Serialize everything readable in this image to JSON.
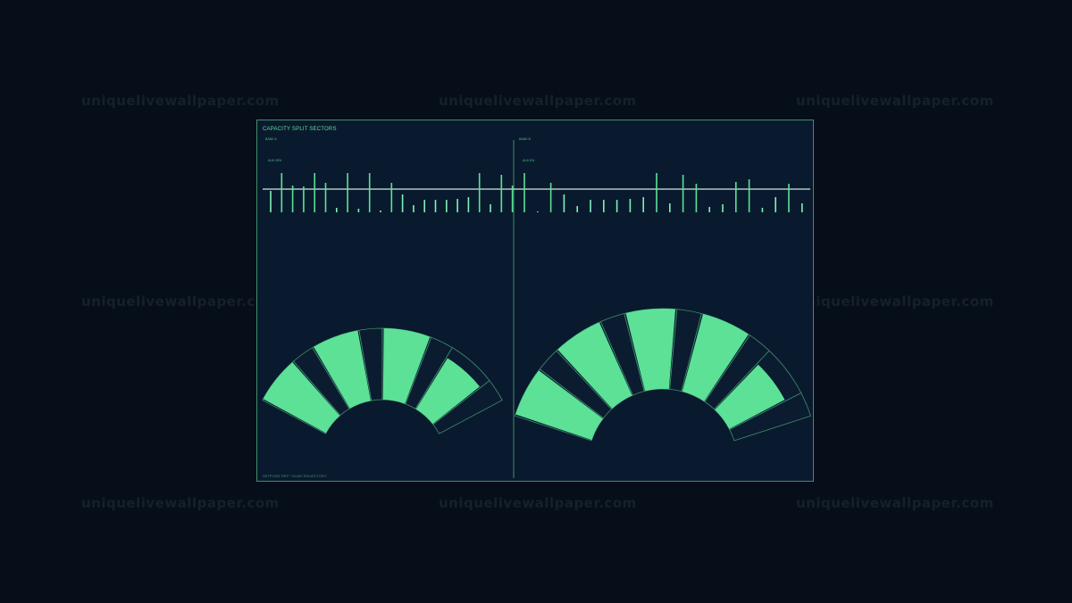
{
  "watermark": "uniquelivewallpaper.com",
  "panel": {
    "title": "CAPACITY SPLIT SECTORS",
    "footer": "SETPOINT REF * SCAN TRAJECTORY"
  },
  "left": {
    "bank_label": "BANK A",
    "sub_label": "AUX 25%"
  },
  "right": {
    "bank_label": "BANK B",
    "sub_label": "AUX 8%"
  },
  "colors": {
    "accent": "#5ce197",
    "panel_bg": "#0a1a2e",
    "page_bg": "#060e19",
    "border": "#3f8e6c"
  },
  "chart_data": [
    {
      "type": "bar",
      "name": "",
      "baseline_value": 26,
      "values": [
        24,
        44,
        30,
        29,
        44,
        33,
        5,
        44,
        4,
        44,
        2,
        33,
        20,
        8,
        14,
        14,
        14,
        15,
        17,
        44,
        9,
        42,
        30
      ]
    },
    {
      "type": "bar",
      "name": "",
      "baseline_value": 26,
      "values": [
        44,
        1,
        33,
        20,
        7,
        14,
        14,
        14,
        15,
        17,
        44,
        10,
        42,
        32,
        6,
        9,
        34,
        37,
        5,
        17,
        32,
        10
      ]
    },
    {
      "type": "radial",
      "name": "",
      "sectors": [
        {
          "fill": 1.0
        },
        {
          "fill": 0.0
        },
        {
          "fill": 1.0
        },
        {
          "fill": 0.0
        },
        {
          "fill": 1.0
        },
        {
          "fill": 0.0
        },
        {
          "fill": 0.84
        },
        {
          "fill": 0.0
        }
      ]
    },
    {
      "type": "radial",
      "name": "",
      "sectors": [
        {
          "fill": 1.0
        },
        {
          "fill": 0.0
        },
        {
          "fill": 1.0
        },
        {
          "fill": 0.0
        },
        {
          "fill": 1.0
        },
        {
          "fill": 0.0
        },
        {
          "fill": 1.0
        },
        {
          "fill": 0.0
        },
        {
          "fill": 0.78
        },
        {
          "fill": 0.0
        }
      ]
    }
  ]
}
